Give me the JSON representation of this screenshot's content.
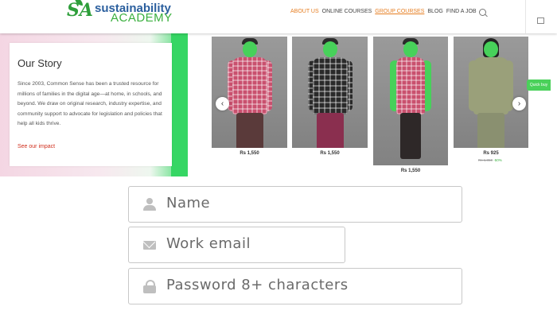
{
  "header": {
    "logo_mark": "SA",
    "logo_line1": "sustainability",
    "logo_line2": "ACADEMY",
    "nav": [
      {
        "label": "ABOUT US"
      },
      {
        "label": "ONLINE COURSES"
      },
      {
        "label": "GROUP COURSES"
      },
      {
        "label": "BLOG"
      },
      {
        "label": "FIND A JOB"
      }
    ]
  },
  "story": {
    "title": "Our Story",
    "text": "Since 2003, Common Sense has been a trusted resource for millions of families in the digital age—at home, in schools, and beyond. We draw on original research, industry expertise, and community support to advocate for legislation and policies that help all kids thrive.",
    "link": "See our impact"
  },
  "products": [
    {
      "price": "Rs 1,550",
      "icon": "red-check-shirt"
    },
    {
      "price": "Rs 1,550",
      "icon": "dark-check-shirt"
    },
    {
      "price": "Rs 1,550",
      "icon": "red-check-shirt-jeans"
    },
    {
      "price": "Rs 925",
      "old_price": "Rs 1,850",
      "discount": "-50%",
      "icon": "olive-shirt"
    }
  ],
  "carousel": {
    "prev": "‹",
    "next": "›",
    "tab": "Quick buy"
  },
  "form": {
    "name_placeholder": "Name",
    "email_placeholder": "Work email",
    "password_placeholder": "Password 8+ characters"
  },
  "colors": {
    "accent_orange": "#e67e22",
    "brand_green": "#3bb03f",
    "brand_blue": "#2b5f9e",
    "link_red": "#d0301e"
  }
}
